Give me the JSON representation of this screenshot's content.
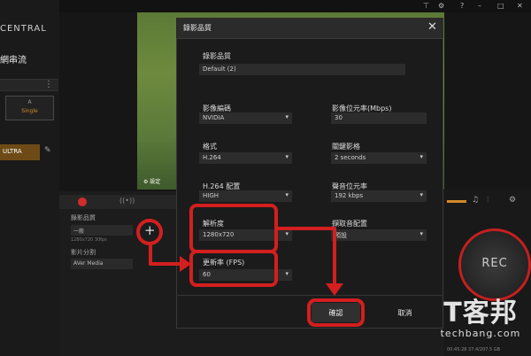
{
  "app": {
    "logo_text": "CENTRAL",
    "nav_title": "網串流",
    "single_card": {
      "top": "A",
      "label": "Single"
    },
    "source_row": "ULTRA",
    "video_settings": "設定",
    "status": "00:45:28  37.4/207.5 GB"
  },
  "lower": {
    "rec_label": "錄影品質",
    "rec_select": "一般",
    "rec_res": "1280x720 30fps",
    "split_label": "影片分割",
    "split_select": "AVer Media"
  },
  "rec_button": "REC",
  "dialog": {
    "title": "錄影品質",
    "close": "✕",
    "preset_label": "錄影品質",
    "preset_value": "Default (2)",
    "encoder_label": "影像編碼",
    "encoder_value": "NVIDIA",
    "vbitrate_label": "影像位元率(Mbps)",
    "vbitrate_value": "30",
    "format_label": "格式",
    "format_value": "H.264",
    "keyframe_label": "關鍵影格",
    "keyframe_value": "2 seconds",
    "profile_label": "H.264 配置",
    "profile_value": "HIGH",
    "abitrate_label": "聲音位元率",
    "abitrate_value": "192 kbps",
    "resolution_label": "解析度",
    "resolution_value": "1280x720",
    "aconfig_label": "擷取音配置",
    "aconfig_value": "預設",
    "fps_label": "更新率 (FPS)",
    "fps_value": "60",
    "confirm": "確認",
    "cancel": "取消"
  },
  "watermark": {
    "big": "T客邦",
    "small": "techbang.com"
  },
  "colors": {
    "accent": "#d38a2a",
    "annotation": "#d31f1f",
    "rec_ring": "#c61f1f"
  },
  "icons": [
    "close-icon",
    "caret-down-icon",
    "plus-icon",
    "headphone-icon",
    "mixer-icon",
    "gear-icon",
    "pencil-icon",
    "kebab-icon"
  ]
}
